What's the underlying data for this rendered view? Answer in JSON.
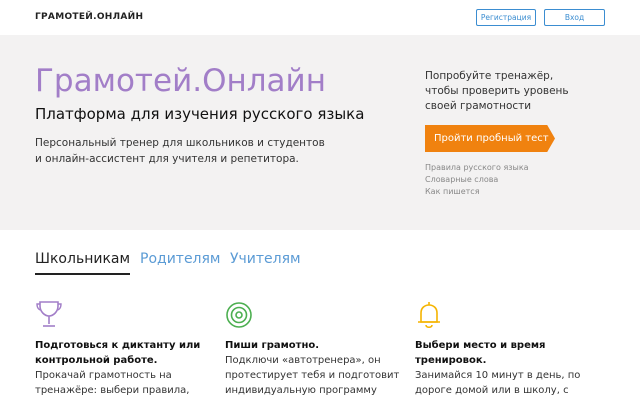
{
  "header": {
    "logo": "ГРАМОТЕЙ.ОНЛАЙН",
    "register_label": "Регистрация",
    "login_label": "Вход"
  },
  "hero": {
    "title": "Грамотей.Онлайн",
    "subtitle": "Платформа для изучения русского языка",
    "description_lines": [
      "Персональный тренер для школьников и студентов",
      "и онлайн-ассистент для учителя и репетитора."
    ],
    "cta_text_lines": [
      "Попробуйте тренажёр,",
      "чтобы проверить уровень",
      "своей грамотности"
    ],
    "cta_button": "Пройти пробный тест",
    "links": [
      "Правила русского языка",
      "Словарные слова",
      "Как пишется"
    ]
  },
  "tabs": [
    {
      "label": "Школьникам",
      "active": true
    },
    {
      "label": "Родителям",
      "active": false
    },
    {
      "label": "Учителям",
      "active": false
    }
  ],
  "features": [
    {
      "icon": "trophy-icon",
      "title_lines": [
        "Подготовься к диктанту или",
        "контрольной работе."
      ],
      "text_lines": [
        "Прокачай грамотность на",
        "тренажёре: выбери правила,"
      ]
    },
    {
      "icon": "target-icon",
      "title_lines": [
        "Пиши грамотно."
      ],
      "text_lines": [
        "Подключи «автотренера», он",
        "протестирует тебя и подготовит",
        "индивидуальную программу"
      ]
    },
    {
      "icon": "bell-icon",
      "title_lines": [
        "Выбери место и время",
        "тренировок."
      ],
      "text_lines": [
        "Занимайся 10 минут в день, по",
        "дороге домой или в школу, с"
      ]
    }
  ],
  "colors": {
    "accent_purple": "#a27ec8",
    "accent_blue": "#3b8dd1",
    "cta_orange": "#f0820f",
    "hero_bg": "#f3f2f2",
    "icon_green": "#4caf50",
    "icon_yellow": "#f5b400"
  }
}
